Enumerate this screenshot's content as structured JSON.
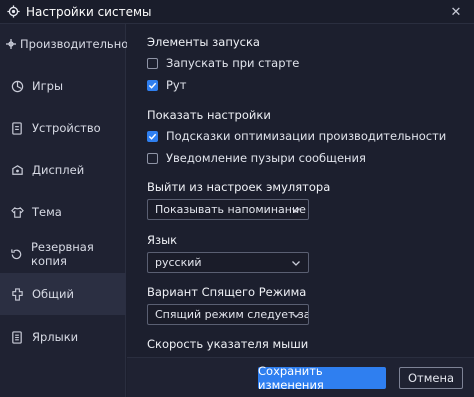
{
  "window": {
    "title": "Настройки системы",
    "close_glyph": "✕"
  },
  "sidebar": {
    "items": [
      {
        "label": "Производительность",
        "icon": "performance-icon",
        "active": false
      },
      {
        "label": "Игры",
        "icon": "games-icon",
        "active": false
      },
      {
        "label": "Устройство",
        "icon": "device-icon",
        "active": false
      },
      {
        "label": "Дисплей",
        "icon": "display-icon",
        "active": false
      },
      {
        "label": "Тема",
        "icon": "theme-icon",
        "active": false
      },
      {
        "label": "Резервная копия",
        "icon": "backup-icon",
        "active": false
      },
      {
        "label": "Общий",
        "icon": "general-icon",
        "active": true
      },
      {
        "label": "Ярлыки",
        "icon": "shortcuts-icon",
        "active": false
      }
    ]
  },
  "content": {
    "startup": {
      "heading": "Элементы запуска",
      "launch_at_startup": {
        "label": "Запускать при старте",
        "checked": false
      },
      "root": {
        "label": "Рут",
        "checked": true
      }
    },
    "show_settings": {
      "heading": "Показать настройки",
      "perf_tips": {
        "label": "Подсказки оптимизации производительности",
        "checked": true
      },
      "bubble_notify": {
        "label": "Уведомление пузыри сообщения",
        "checked": false
      }
    },
    "exit_emulator": {
      "heading": "Выйти из настроек эмулятора",
      "value": "Показывать напоминание"
    },
    "language": {
      "heading": "Язык",
      "value": "русский"
    },
    "sleep_mode": {
      "heading": "Вариант Спящего Режима",
      "value": "Спящий режим следует за сист"
    },
    "pointer_speed": {
      "heading": "Скорость указателя мыши"
    }
  },
  "footer": {
    "save_label": "Сохранить изменения",
    "cancel_label": "Отмена"
  },
  "colors": {
    "accent": "#2f7ff0",
    "background": "#1c1f2e",
    "sidebar": "#1f2232",
    "active_item": "#2b2f42"
  }
}
